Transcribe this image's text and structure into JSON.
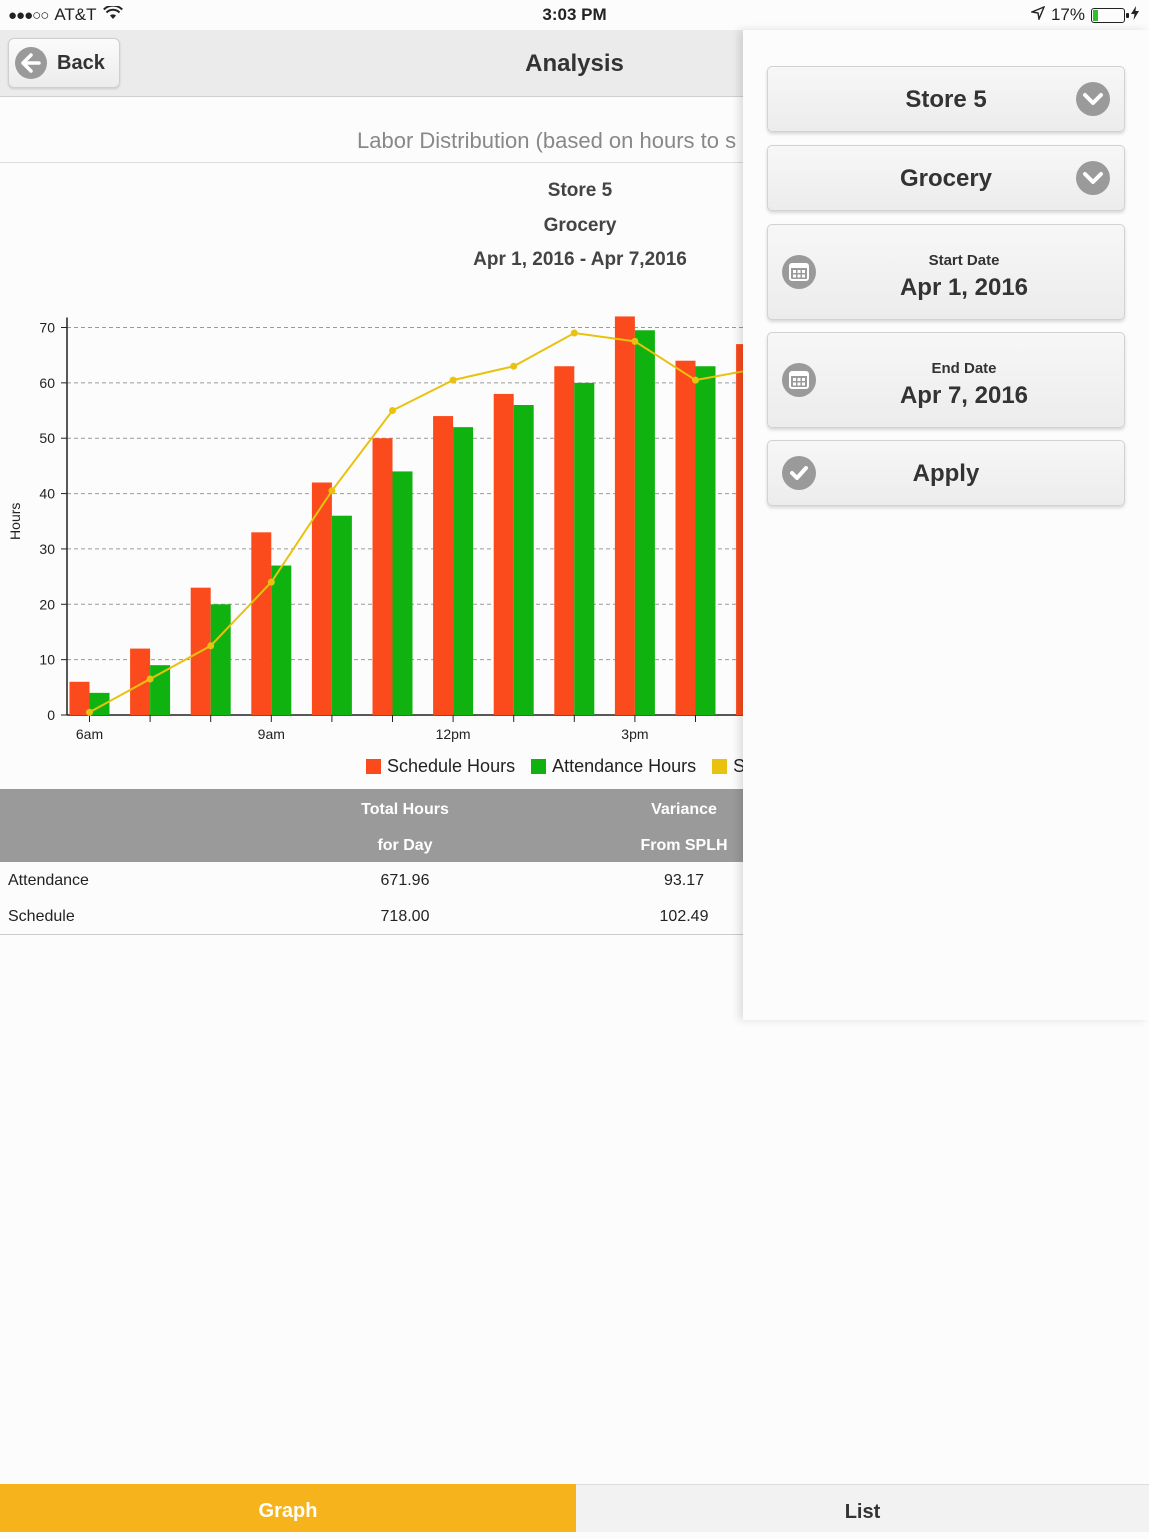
{
  "status_bar": {
    "carrier": "AT&T",
    "time": "3:03 PM",
    "battery": "17%",
    "battery_level": 0.17
  },
  "nav": {
    "back_label": "Back",
    "title": "Analysis"
  },
  "subtitle": "Labor Distribution (based on hours to s",
  "chart_header": {
    "store": "Store 5",
    "department": "Grocery",
    "date_range": "Apr 1, 2016 - Apr 7,2016"
  },
  "chart_data": {
    "type": "bar",
    "ylabel": "Hours",
    "ylim": [
      0,
      70
    ],
    "yticks": [
      0,
      10,
      20,
      30,
      40,
      50,
      60,
      70
    ],
    "x_tick_labels": [
      "6am",
      "9am",
      "12pm",
      "3pm"
    ],
    "grid": "horizontal dashed",
    "series": [
      {
        "name": "Schedule Hours",
        "type": "bar",
        "color": "#fb4a1c",
        "values": [
          6,
          12,
          23,
          33,
          42,
          50,
          54,
          58,
          63,
          72,
          64,
          67
        ]
      },
      {
        "name": "Attendance Hours",
        "type": "bar",
        "color": "#0fb20f",
        "values": [
          4,
          9,
          20,
          27,
          36,
          44,
          52,
          56,
          60,
          69.5,
          63,
          null
        ]
      },
      {
        "name": "S",
        "type": "line",
        "color": "#e8c20f",
        "values": [
          0.5,
          6.5,
          12.5,
          24,
          40.5,
          55,
          60.5,
          63,
          69,
          67.5,
          60.5,
          62.5
        ]
      }
    ],
    "legend_position": "bottom"
  },
  "table": {
    "headers": [
      {
        "line1": "",
        "line2": ""
      },
      {
        "line1": "Total Hours",
        "line2": "for Day"
      },
      {
        "line1": "Variance",
        "line2": "From SPLH"
      }
    ],
    "rows": [
      {
        "label": "Attendance",
        "total": "671.96",
        "variance": "93.17"
      },
      {
        "label": "Schedule",
        "total": "718.00",
        "variance": "102.49"
      }
    ]
  },
  "panel": {
    "store": "Store 5",
    "department": "Grocery",
    "start_date_label": "Start Date",
    "start_date": "Apr 1, 2016",
    "end_date_label": "End Date",
    "end_date": "Apr 7, 2016",
    "apply_label": "Apply"
  },
  "tabs": {
    "graph": "Graph",
    "list": "List"
  }
}
